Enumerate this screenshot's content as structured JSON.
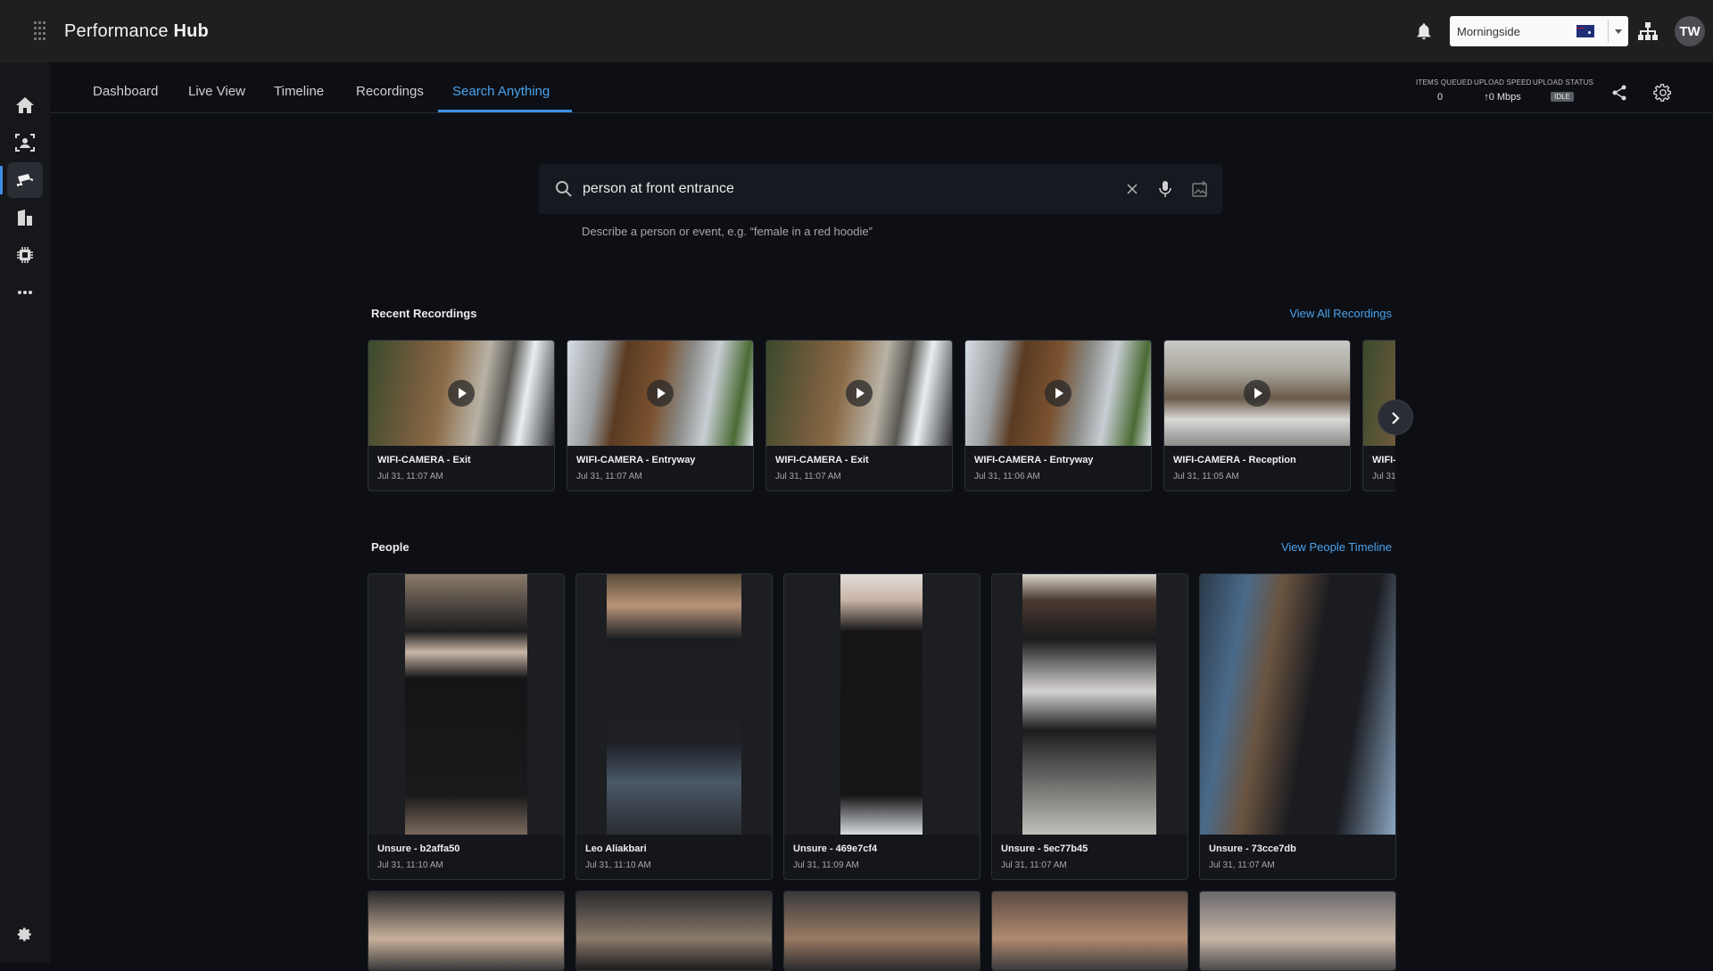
{
  "app": {
    "brand_light": "Performance ",
    "brand_bold": "Hub"
  },
  "header": {
    "location": "Morningside",
    "avatar_initials": "TW"
  },
  "tabs": [
    {
      "label": "Dashboard"
    },
    {
      "label": "Live View"
    },
    {
      "label": "Timeline"
    },
    {
      "label": "Recordings"
    },
    {
      "label": "Search Anything",
      "active": true
    }
  ],
  "stats": {
    "items_queued_label": "ITEMS QUEUED",
    "items_queued": "0",
    "upload_speed_label": "UPLOAD SPEED",
    "upload_speed": "↑0 Mbps",
    "upload_status_label": "UPLOAD STATUS",
    "upload_status": "IDLE"
  },
  "search": {
    "query": "person at front entrance",
    "hint": "Describe a person or event, e.g. “female in a red hoodie”"
  },
  "recent": {
    "title": "Recent Recordings",
    "link": "View All Recordings",
    "items": [
      {
        "name": "WIFI-CAMERA - Exit",
        "time": "Jul 31, 11:07 AM"
      },
      {
        "name": "WIFI-CAMERA - Entryway",
        "time": "Jul 31, 11:07 AM"
      },
      {
        "name": "WIFI-CAMERA - Exit",
        "time": "Jul 31, 11:07 AM"
      },
      {
        "name": "WIFI-CAMERA - Entryway",
        "time": "Jul 31, 11:06 AM"
      },
      {
        "name": "WIFI-CAMERA - Reception",
        "time": "Jul 31, 11:05 AM"
      },
      {
        "name": "WIFI-",
        "time": "Jul 31"
      }
    ]
  },
  "people": {
    "title": "People",
    "link": "View People Timeline",
    "items": [
      {
        "name": "Unsure - b2affa50",
        "time": "Jul 31, 11:10 AM"
      },
      {
        "name": "Leo Aliakbari",
        "time": "Jul 31, 11:10 AM"
      },
      {
        "name": "Unsure - 469e7cf4",
        "time": "Jul 31, 11:09 AM"
      },
      {
        "name": "Unsure - 5ec77b45",
        "time": "Jul 31, 11:07 AM"
      },
      {
        "name": "Unsure - 73cce7db",
        "time": "Jul 31, 11:07 AM"
      }
    ]
  },
  "colors": {
    "accent": "#3d8ee6",
    "link": "#4aa2ee",
    "topbar": "#1f1f20",
    "background": "#0d0f14"
  }
}
